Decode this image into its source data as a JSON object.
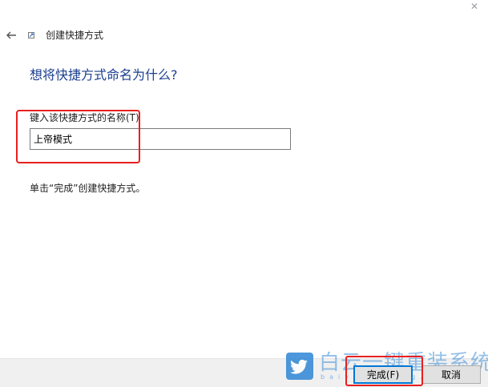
{
  "window": {
    "title": "创建快捷方式"
  },
  "heading": "想将快捷方式命名为什么?",
  "name_field": {
    "label": "键入该快捷方式的名称(T)",
    "value": "上帝模式"
  },
  "instruction": "单击“完成”创建快捷方式。",
  "buttons": {
    "finish": "完成(F)",
    "cancel": "取消"
  },
  "watermark": {
    "text": "白云一键重装系统",
    "url": "baiyunxitong.com"
  },
  "colors": {
    "heading": "#1c3f8f",
    "highlight": "#e6201f",
    "focus": "#0078d7"
  },
  "icons": {
    "back": "back-arrow-icon",
    "wizard": "shortcut-wizard-icon",
    "close": "close-icon",
    "watermark": "twitter-bird-icon"
  }
}
